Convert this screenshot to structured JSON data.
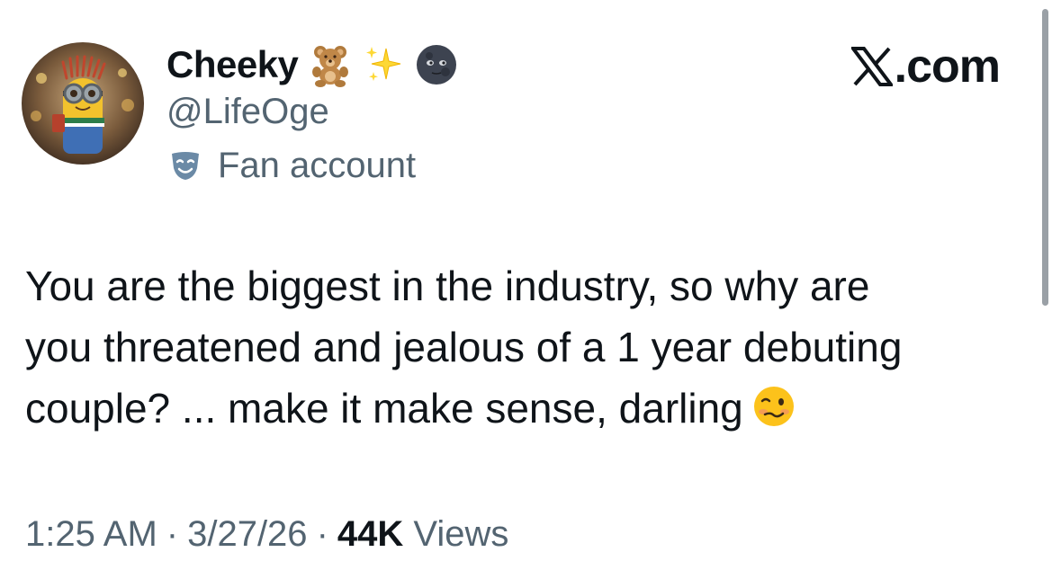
{
  "author": {
    "display_name": "Cheeky",
    "handle": "@LifeOge",
    "label": "Fan account",
    "name_emojis": [
      "teddy-bear-icon",
      "sparkles-icon",
      "new-moon-face-icon"
    ]
  },
  "brand": {
    "suffix": ".com"
  },
  "tweet": {
    "lines": [
      "You are the biggest in the industry,  so why are",
      "you threatened and jealous of a 1 year debuting",
      "couple? ... make it make sense, darling"
    ],
    "trailing_emoji": "woozy-face-icon"
  },
  "meta": {
    "time": "1:25 AM",
    "separator": "·",
    "date": "3/27/26",
    "views_count": "44K",
    "views_label": "Views"
  },
  "colors": {
    "text_primary": "#0f1419",
    "text_secondary": "#536471",
    "background": "#ffffff"
  }
}
